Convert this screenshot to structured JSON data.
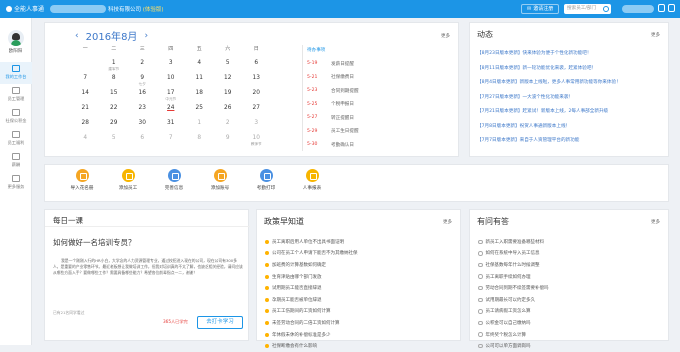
{
  "topbar": {
    "logo_text": "全能人事通",
    "company_suffix": "科技有限公司",
    "version": "(体验版)",
    "invite_label": "邀请注册",
    "search_placeholder": "搜索员工/部门"
  },
  "sidebar": {
    "user_name": "欧阳阳",
    "items": [
      {
        "label": "我的工作台",
        "active": true,
        "icon": "desk-icon"
      },
      {
        "label": "员工管理",
        "active": false,
        "icon": "staff-icon"
      },
      {
        "label": "社保公积金",
        "active": false,
        "icon": "insurance-icon"
      },
      {
        "label": "员工福利",
        "active": false,
        "icon": "gift-icon"
      },
      {
        "label": "薪酬",
        "active": false,
        "icon": "salary-icon"
      },
      {
        "label": "更多服务",
        "active": false,
        "icon": "more-icon"
      }
    ]
  },
  "calendar": {
    "year": "2016年",
    "month": "8月",
    "more": "更多",
    "weekdays": [
      "一",
      "二",
      "三",
      "四",
      "五",
      "六",
      "日"
    ],
    "weeks": [
      [
        {
          "d": "",
          "s": ""
        },
        {
          "d": "1",
          "s": "建军节"
        },
        {
          "d": "2",
          "s": ""
        },
        {
          "d": "3",
          "s": ""
        },
        {
          "d": "4",
          "s": ""
        },
        {
          "d": "5",
          "s": ""
        },
        {
          "d": "6",
          "s": ""
        }
      ],
      [
        {
          "d": "7",
          "s": ""
        },
        {
          "d": "8",
          "s": ""
        },
        {
          "d": "9",
          "s": "七夕"
        },
        {
          "d": "10",
          "s": ""
        },
        {
          "d": "11",
          "s": ""
        },
        {
          "d": "12",
          "s": ""
        },
        {
          "d": "13",
          "s": ""
        }
      ],
      [
        {
          "d": "14",
          "s": ""
        },
        {
          "d": "15",
          "s": ""
        },
        {
          "d": "16",
          "s": ""
        },
        {
          "d": "17",
          "s": "中元节"
        },
        {
          "d": "18",
          "s": ""
        },
        {
          "d": "19",
          "s": ""
        },
        {
          "d": "20",
          "s": ""
        }
      ],
      [
        {
          "d": "21",
          "s": ""
        },
        {
          "d": "22",
          "s": ""
        },
        {
          "d": "23",
          "s": ""
        },
        {
          "d": "24",
          "s": "",
          "today": true
        },
        {
          "d": "25",
          "s": ""
        },
        {
          "d": "26",
          "s": ""
        },
        {
          "d": "27",
          "s": ""
        }
      ],
      [
        {
          "d": "28",
          "s": ""
        },
        {
          "d": "29",
          "s": ""
        },
        {
          "d": "30",
          "s": ""
        },
        {
          "d": "31",
          "s": ""
        },
        {
          "d": "1",
          "s": "",
          "muted": true
        },
        {
          "d": "2",
          "s": "",
          "muted": true
        },
        {
          "d": "3",
          "s": "",
          "muted": true
        }
      ],
      [
        {
          "d": "4",
          "s": "",
          "muted": true
        },
        {
          "d": "5",
          "s": "",
          "muted": true
        },
        {
          "d": "6",
          "s": "",
          "muted": true
        },
        {
          "d": "7",
          "s": "",
          "muted": true
        },
        {
          "d": "8",
          "s": "",
          "muted": true
        },
        {
          "d": "9",
          "s": "",
          "muted": true
        },
        {
          "d": "10",
          "s": "教师节",
          "muted": true
        }
      ]
    ],
    "list_header": "待办事项",
    "events": [
      {
        "date": "5-19",
        "text": "发薪日提醒"
      },
      {
        "date": "5-21",
        "text": "社保缴费日"
      },
      {
        "date": "5-23",
        "text": "合同到期提醒"
      },
      {
        "date": "5-25",
        "text": "个税申报日"
      },
      {
        "date": "5-27",
        "text": "转正提醒日"
      },
      {
        "date": "5-29",
        "text": "员工生日提醒"
      },
      {
        "date": "5-30",
        "text": "考勤确认日"
      }
    ]
  },
  "news": {
    "title": "动态",
    "more": "更多",
    "items": [
      "【8月23日版本更新】快来体验为便于个性化新功能吧！",
      "【8月11日版本更新】新一轮功能优化来袭，赶紧体验吧！",
      "【8月4日版本更新】新版本上线啦，更多人事常用新功能等你来体验！",
      "【7月27日版本更新】一大波个性化功能来袭！",
      "【7月21日版本更新】赶紧试！新版本上线，2每人事部全新升级",
      "【7月8日版本更新】祝贺人事通新版本上线！",
      "【7月7日版本更新】来自于人资管理平台的新功能"
    ]
  },
  "quick": [
    {
      "label": "导入花名册",
      "color": "#f5a623",
      "icon": "import-icon"
    },
    {
      "label": "添加员工",
      "color": "#f7b500",
      "icon": "add-staff-icon"
    },
    {
      "label": "完善信息",
      "color": "#4a90e2",
      "icon": "info-icon"
    },
    {
      "label": "添加账号",
      "color": "#f5a623",
      "icon": "account-icon"
    },
    {
      "label": "考勤打印",
      "color": "#4a90e2",
      "icon": "print-icon"
    },
    {
      "label": "人事报表",
      "color": "#f7b500",
      "icon": "report-icon"
    }
  ],
  "daily": {
    "title": "每日一课",
    "question": "如何做好一名培训专员？",
    "body": "我是一个刚刚入行的HR小白，大学念的人力资源管理专业，通过校招进入现在的公司，现在公司有300多人，是重要的产业零售环节。最近老板想让我做培训工作，但我对培训真的不太了解，也缺乏相关经验，请问应该从哪些方面入手？要做哪些工作？需要具备哪些能力？希望各位前辈指点一二，谢谢！",
    "footer": "已有21名同学看过",
    "link": "365人已学完",
    "button": "去打卡学习"
  },
  "policy": {
    "title": "政策早知道",
    "more": "更多",
    "items": [
      "员工离职后用人单位不出具书面证明",
      "公司在员工个人申请下能否不为其缴纳社保",
      "加班费的计算基数如何确定",
      "生育津贴由哪个部门发放",
      "试用期员工能否直接辞退",
      "孕期员工能否被单位辞退",
      "员工工伤期间的工资如何计算",
      "未签劳动合同的二倍工资如何计算",
      "年休假未休的补偿标准是多少",
      "社保断缴会有什么影响"
    ]
  },
  "faq": {
    "title": "有问有答",
    "more": "更多",
    "items": [
      "新员工入职需要准备哪些材料",
      "如何在系统中导入员工信息",
      "社保基数每年什么时候调整",
      "员工离职手续如何办理",
      "劳动合同到期不续签需要补偿吗",
      "试用期最长可以约定多久",
      "员工请病假工资怎么算",
      "公积金可以自己缴纳吗",
      "年终奖个税怎么计算",
      "公司可以单方面调岗吗"
    ]
  }
}
